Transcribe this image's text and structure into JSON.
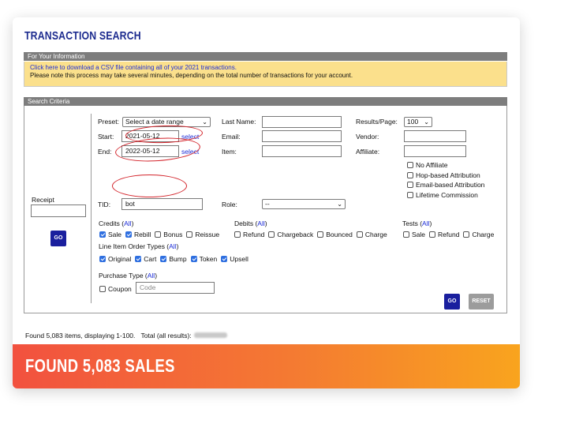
{
  "title": "TRANSACTION SEARCH",
  "info": {
    "header": "For Your Information",
    "link_text": "Click here to download a CSV file containing all of your 2021 transactions.",
    "note": "Please note this process may take several minutes, depending on the total number of transactions for your account."
  },
  "criteria": {
    "header": "Search Criteria",
    "receipt_label": "Receipt",
    "receipt_value": "",
    "go_label": "GO",
    "reset_label": "RESET",
    "preset_label": "Preset:",
    "preset_value": "Select a date range",
    "start_label": "Start:",
    "start_value": "2021-05-12",
    "end_label": "End:",
    "end_value": "2022-05-12",
    "select_link": "select",
    "last_name_label": "Last Name:",
    "email_label": "Email:",
    "item_label": "Item:",
    "results_label": "Results/Page:",
    "results_value": "100",
    "vendor_label": "Vendor:",
    "affiliate_label": "Affiliate:",
    "affiliate_options": [
      "No Affiliate",
      "Hop-based Attribution",
      "Email-based Attribution",
      "Lifetime Commission"
    ],
    "tid_label": "TID:",
    "tid_value": "bot",
    "role_label": "Role:",
    "role_value": "--",
    "credits_label": "Credits (",
    "debits_label": "Debits (",
    "tests_label": "Tests (",
    "all_link": "All",
    "close_paren": ")",
    "credits": [
      {
        "label": "Sale",
        "checked": true
      },
      {
        "label": "Rebill",
        "checked": true
      },
      {
        "label": "Bonus",
        "checked": false
      },
      {
        "label": "Reissue",
        "checked": false
      }
    ],
    "debits": [
      {
        "label": "Refund",
        "checked": false
      },
      {
        "label": "Chargeback",
        "checked": false
      },
      {
        "label": "Bounced",
        "checked": false
      },
      {
        "label": "Charge",
        "checked": false
      }
    ],
    "tests": [
      {
        "label": "Sale",
        "checked": false
      },
      {
        "label": "Refund",
        "checked": false
      },
      {
        "label": "Charge",
        "checked": false
      }
    ],
    "line_item_label": "Line Item Order Types (",
    "line_items": [
      {
        "label": "Original",
        "checked": true
      },
      {
        "label": "Cart",
        "checked": true
      },
      {
        "label": "Bump",
        "checked": true
      },
      {
        "label": "Token",
        "checked": true
      },
      {
        "label": "Upsell",
        "checked": true
      }
    ],
    "purchase_type_label": "Purchase Type (",
    "coupon_label": "Coupon",
    "code_placeholder": "Code"
  },
  "found_text": "Found 5,083 items, displaying 1-100.",
  "total_label": "Total (all results):",
  "banner_text": "FOUND 5,083 SALES",
  "colors": {
    "title": "#1d2c8f",
    "accent_button": "#1a1f9e",
    "info_bg": "#fbe08c",
    "annotation": "#d3232a",
    "banner_start": "#f2513f",
    "banner_end": "#f9a41e"
  }
}
